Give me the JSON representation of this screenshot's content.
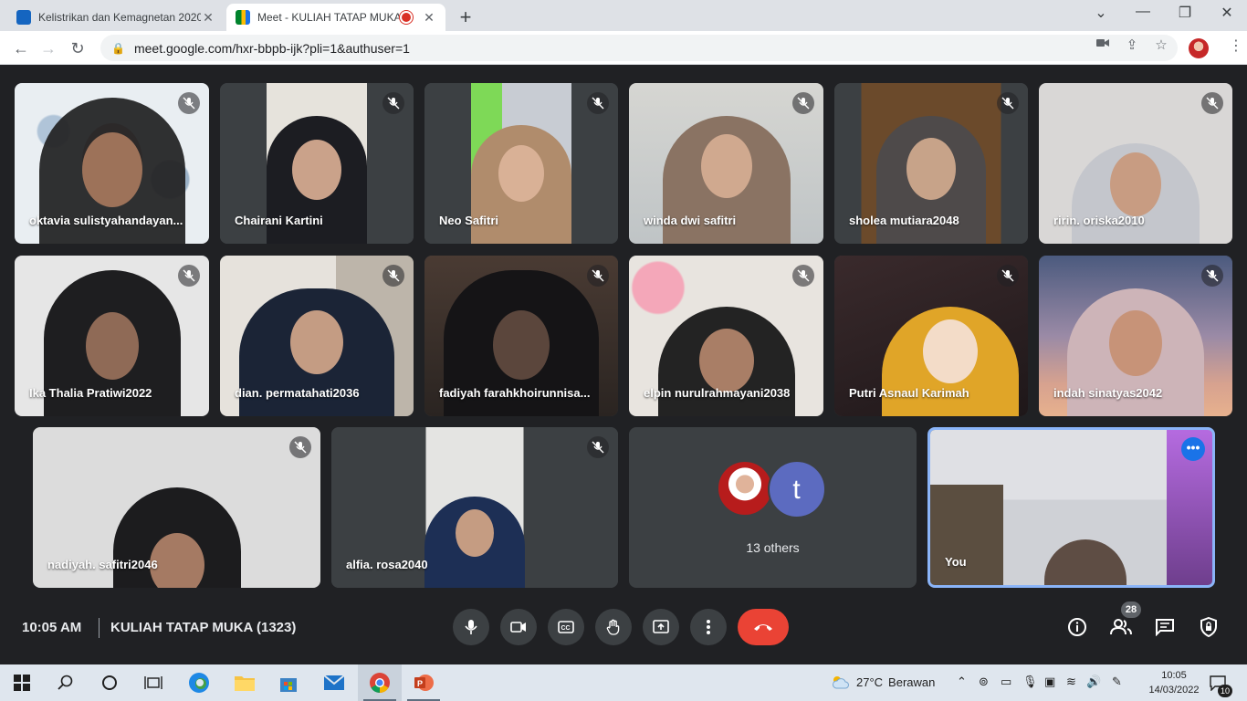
{
  "browser": {
    "tabs": [
      {
        "title": "Kelistrikan dan Kemagnetan 2020",
        "active": false,
        "close": "✕"
      },
      {
        "title": "Meet - KULIAH TATAP MUKA",
        "active": true,
        "close": "✕"
      }
    ],
    "new_tab": "+",
    "window_controls": {
      "dropdown": "⌄",
      "minimize": "—",
      "restore": "❐",
      "close": "✕"
    },
    "url": "meet.google.com/hxr-bbpb-ijk?pli=1&authuser=1"
  },
  "participants": [
    {
      "name": "oktavia sulistyahandayan..."
    },
    {
      "name": "Chairani Kartini"
    },
    {
      "name": "Neo Safitri"
    },
    {
      "name": "winda dwi safitri"
    },
    {
      "name": "sholea mutiara2048"
    },
    {
      "name": "ririn. oriska2010"
    },
    {
      "name": "Ika Thalia Pratiwi2022"
    },
    {
      "name": "dian. permatahati2036"
    },
    {
      "name": "fadiyah farahkhoirunnisa..."
    },
    {
      "name": "elpin nurulrahmayani2038"
    },
    {
      "name": "Putri Asnaul Karimah"
    },
    {
      "name": "indah sinatyas2042"
    },
    {
      "name": "nadiyah. safitri2046"
    },
    {
      "name": "alfia. rosa2040"
    }
  ],
  "others": {
    "avatar_letter": "t",
    "count_label": "13 others"
  },
  "self_tile": {
    "name": "You"
  },
  "meeting": {
    "time": "10:05 AM",
    "name": "KULIAH TATAP MUKA (1323)",
    "participant_count": "28"
  },
  "taskbar": {
    "weather_temp": "27°C",
    "weather_desc": "Berawan",
    "time": "10:05",
    "date": "14/03/2022",
    "notifications": "10"
  },
  "colors": {
    "meet_bg": "#202124",
    "tile_bg": "#3c4043",
    "end_call": "#ea4335",
    "self_border": "#8ab4f8",
    "accent": "#1a73e8"
  }
}
